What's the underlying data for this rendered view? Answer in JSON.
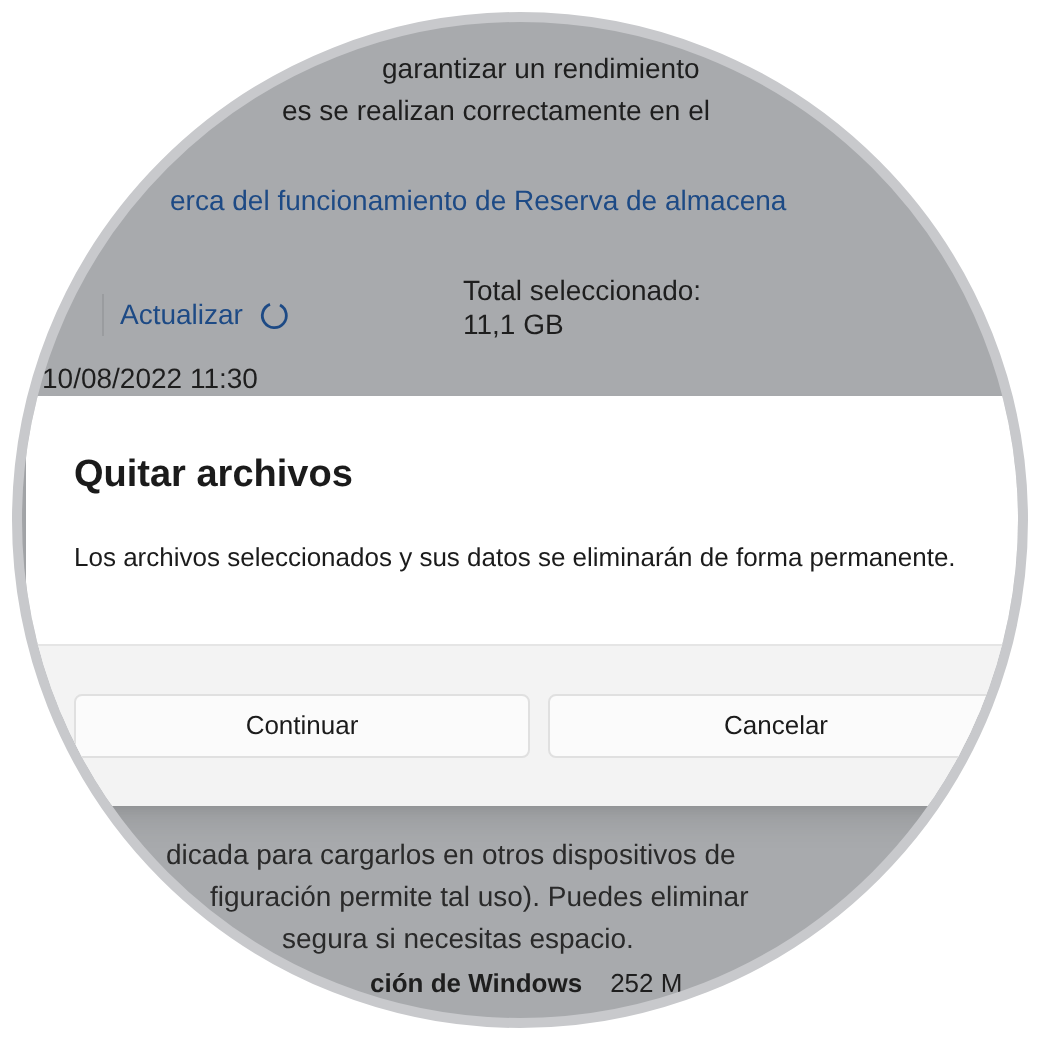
{
  "background": {
    "description_lines": [
      "garantizar un rendimiento",
      "es se realizan correctamente en el"
    ],
    "link": "erca del funcionamiento de Reserva de almacena",
    "refresh_button": "Actualizar",
    "total_selected": "Total seleccionado: 11,1 GB",
    "date": "10/08/2022 11:30",
    "lower_lines": [
      "dicada para cargarlos en otros dispositivos de",
      "figuración permite tal uso). Puedes eliminar",
      "segura si necesitas espacio."
    ],
    "item": {
      "name": "ción de Windows",
      "size": "252 M"
    }
  },
  "dialog": {
    "title": "Quitar archivos",
    "message": "Los archivos seleccionados y sus datos se eliminarán de forma permanente.",
    "buttons": [
      {
        "label": "Continuar"
      },
      {
        "label": "Cancelar"
      }
    ]
  }
}
